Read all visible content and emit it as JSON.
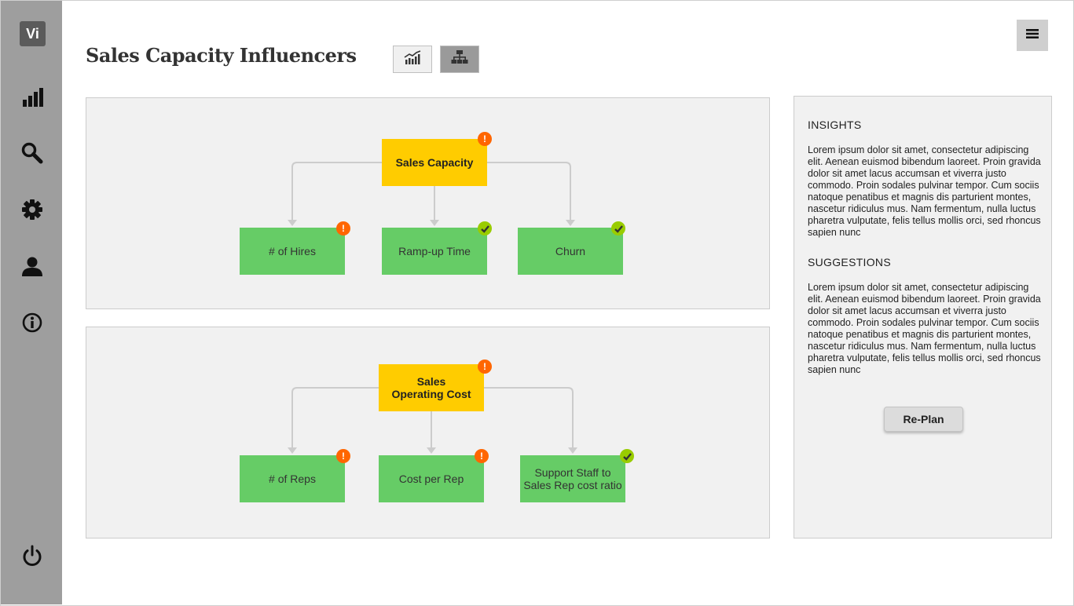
{
  "app": {
    "logo_text": "Vi"
  },
  "sidebar": {
    "items": [
      {
        "icon": "bar-chart-icon"
      },
      {
        "icon": "search-icon"
      },
      {
        "icon": "gear-icon"
      },
      {
        "icon": "user-icon"
      },
      {
        "icon": "info-icon"
      }
    ],
    "bottom": {
      "icon": "power-icon"
    }
  },
  "header": {
    "title": "Sales Capacity Influencers",
    "view_toggle": [
      {
        "icon": "line-chart-icon",
        "active": false
      },
      {
        "icon": "org-chart-icon",
        "active": true
      }
    ],
    "menu_icon": "hamburger-icon"
  },
  "trees": [
    {
      "root": {
        "label": "Sales Capacity",
        "status": "warning"
      },
      "children": [
        {
          "label": "# of Hires",
          "status": "warning"
        },
        {
          "label": "Ramp-up Time",
          "status": "ok"
        },
        {
          "label": "Churn",
          "status": "ok"
        }
      ]
    },
    {
      "root": {
        "label": "Sales\nOperating Cost",
        "status": "warning"
      },
      "children": [
        {
          "label": "# of Reps",
          "status": "warning"
        },
        {
          "label": "Cost per Rep",
          "status": "warning"
        },
        {
          "label": "Support Staff to\nSales Rep cost ratio",
          "status": "ok"
        }
      ]
    }
  ],
  "insights": {
    "title": "INSIGHTS",
    "text": "Lorem ipsum dolor sit amet, consectetur adipiscing elit. Aenean euismod bibendum laoreet. Proin gravida dolor sit amet lacus accumsan et viverra justo commodo. Proin sodales pulvinar tempor. Cum sociis natoque penatibus et magnis dis parturient montes, nascetur ridiculus mus. Nam fermentum, nulla luctus pharetra vulputate, felis tellus mollis orci, sed rhoncus sapien nunc"
  },
  "suggestions": {
    "title": "SUGGESTIONS",
    "text": "Lorem ipsum dolor sit amet, consectetur adipiscing elit. Aenean euismod bibendum laoreet. Proin gravida dolor sit amet lacus accumsan et viverra justo commodo. Proin sodales pulvinar tempor. Cum sociis natoque penatibus et magnis dis parturient montes, nascetur ridiculus mus. Nam fermentum, nulla luctus pharetra vulputate, felis tellus mollis orci, sed rhoncus sapien nunc"
  },
  "actions": {
    "replan_label": "Re-Plan"
  },
  "colors": {
    "sidebar": "#9e9e9e",
    "root_node": "#ffcc00",
    "leaf_node": "#66cc66",
    "warning": "#ff6600",
    "ok": "#99cc00",
    "panel": "#f1f1f1"
  }
}
